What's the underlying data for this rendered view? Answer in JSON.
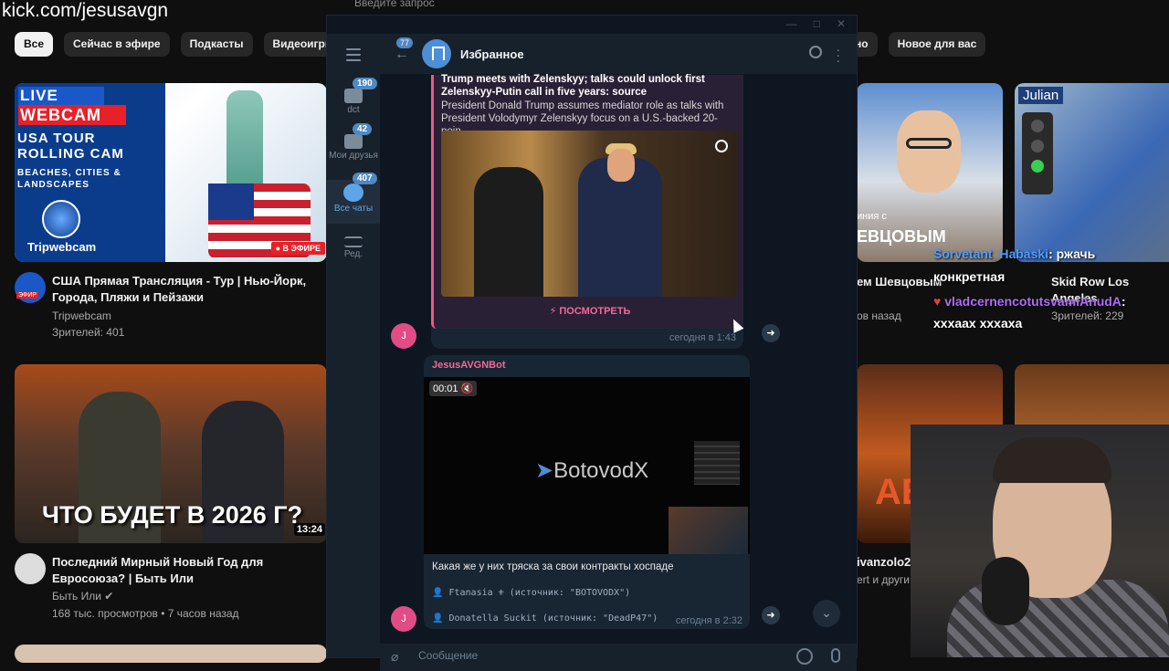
{
  "overlay": {
    "kick_url": "kick.com/jesusavgn"
  },
  "youtube": {
    "chips_left": [
      "Все",
      "Сейчас в эфире",
      "Подкасты",
      "Видеоигры"
    ],
    "chips_right": [
      "но",
      "Новое для вас"
    ],
    "videos": [
      {
        "thumb_live": "LIVE",
        "thumb_webcam": "WEBCAM",
        "thumb_line1": "USA TOUR ROLLING CAM",
        "thumb_line2": "BEACHES, CITIES & LANDSCAPES",
        "thumb_brand": "Tripwebcam",
        "thumb_onair": "● В ЭФИРЕ",
        "avatar_label": "ЭФИР",
        "title": "США Прямая Трансляция - Тур | Нью-Йорк, Города, Пляжи и Пейзажи",
        "channel": "Tripwebcam",
        "meta": "Зрителей: 401"
      },
      {
        "thumb_headline": "ЧТО БУДЕТ В 2026 Г?",
        "duration": "13:24",
        "title": "Последний Мирный Новый Год для Евросоюза? | Быть Или",
        "channel": "Быть Или",
        "meta": "168 тыс. просмотров • 7 часов назад"
      }
    ],
    "right_cards": {
      "card1_caption": "иния с",
      "card1_caption2": "ЕВЦОВЫМ",
      "card1_title": "ем Шевцовым",
      "card1_meta": "ов назад",
      "card2_sign": "Julian",
      "card2_title": "Skid Row Los Angeles",
      "card2_meta": "Зрителей: 229",
      "card3_big": "АБ",
      "card3_title": "ivanzolo2",
      "card3_meta": "ert и други"
    },
    "stream_chat": [
      {
        "user": "Sorvetant_Habaski",
        "text": ": ржачь"
      },
      {
        "user": "",
        "text": "конкретная"
      },
      {
        "user": "vladcernencotutsvamiAnudA",
        "text": ":"
      },
      {
        "user": "",
        "text": "хххаах хххаха"
      }
    ]
  },
  "telegram": {
    "search_placeholder": "Введите запрос",
    "window_controls": [
      "—",
      "□",
      "✕"
    ],
    "folders": [
      {
        "label": "dct",
        "badge": "190",
        "active": false
      },
      {
        "label": "Мои друзья",
        "badge": "42",
        "active": false
      },
      {
        "label": "Все чаты",
        "badge": "407",
        "active": true
      },
      {
        "label": "Ред.",
        "badge": "",
        "active": false
      }
    ],
    "header": {
      "back_badge": "77",
      "title": "Избранное"
    },
    "message1": {
      "quote_title": "Trump meets with Zelenskyy; talks could unlock first Zelenskyy-Putin call in five years: source",
      "quote_text": "President Donald Trump assumes mediator role as talks with President Volodymyr Zelenskyy focus on a U.S.-backed 20-poin...",
      "view_button": "⚡ ПОСМОТРЕТЬ",
      "time": "сегодня в 1:43",
      "avatar": "J"
    },
    "message2": {
      "sender": "JesusAVGNBot",
      "video_time": "00:01",
      "video_logo": "BotovodX",
      "caption": "Какая же у них тряска за свои контракты хоспаде",
      "sources": [
        "👤 Ftanasia ⚜ (источник: \"BOTOVODX\")",
        "👤 Donatella Suckit (источник: \"DeadP47\")"
      ],
      "time": "сегодня в 2:32",
      "avatar": "J"
    },
    "composer_placeholder": "Сообщение"
  }
}
